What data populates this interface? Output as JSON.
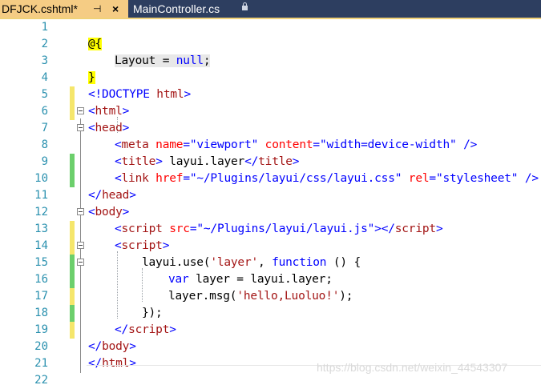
{
  "tabs": [
    {
      "label": "DFJCK.cshtml*",
      "pin": "⊣",
      "close": "×",
      "active": true
    },
    {
      "label": "MainController.cs",
      "locked": true,
      "active": false
    }
  ],
  "editor": {
    "line_numbers": [
      "1",
      "2",
      "3",
      "4",
      "5",
      "6",
      "7",
      "8",
      "9",
      "10",
      "11",
      "12",
      "13",
      "14",
      "15",
      "16",
      "17",
      "18",
      "19",
      "20",
      "21",
      "22"
    ],
    "l2": {
      "razor": "@{"
    },
    "l3": {
      "layout": "Layout",
      "eq": " = ",
      "null": "null",
      "semi": ";"
    },
    "l4": {
      "razor": "}"
    },
    "l5": {
      "open": "<!DOCTYPE",
      "name": " html",
      "close": ">"
    },
    "l6": {
      "open": "<",
      "tag": "html",
      "close": ">"
    },
    "l7": {
      "open": "<",
      "tag": "head",
      "close": ">"
    },
    "l8": {
      "open": "<",
      "tag": "meta",
      "a1": " name",
      "eq1": "=",
      "v1": "\"viewport\"",
      "a2": " content",
      "eq2": "=",
      "v2": "\"width=device-width\"",
      "close": " />"
    },
    "l9": {
      "open": "<",
      "tag": "title",
      "close": ">",
      "text": " layui.layer",
      "open2": "</",
      "tag2": "title",
      "close2": ">"
    },
    "l10": {
      "open": "<",
      "tag": "link",
      "a1": " href",
      "eq1": "=",
      "v1": "\"~/Plugins/layui/css/layui.css\"",
      "a2": " rel",
      "eq2": "=",
      "v2": "\"stylesheet\"",
      "close": " />"
    },
    "l11": {
      "open": "</",
      "tag": "head",
      "close": ">"
    },
    "l12": {
      "open": "<",
      "tag": "body",
      "close": ">"
    },
    "l13": {
      "open": "<",
      "tag": "script",
      "a1": " src",
      "eq1": "=",
      "v1": "\"~/Plugins/layui/layui.js\"",
      "close": ">",
      "open2": "</",
      "tag2": "script",
      "close2": ">"
    },
    "l14": {
      "open": "<",
      "tag": "script",
      "close": ">"
    },
    "l15": {
      "p1": "layui.use(",
      "s1": "'layer'",
      "p2": ", ",
      "kw": "function",
      "p3": " () {"
    },
    "l16": {
      "kw": "var",
      "p1": " layer = layui.layer;"
    },
    "l17": {
      "p1": "layer.msg(",
      "s1": "'hello,Luoluo!'",
      "p2": ");"
    },
    "l18": {
      "p1": "});"
    },
    "l19": {
      "open": "</",
      "tag": "script",
      "close": ">"
    },
    "l20": {
      "open": "</",
      "tag": "body",
      "close": ">"
    },
    "l21": {
      "open": "</",
      "tag": "html",
      "close": ">"
    }
  },
  "colors": {
    "tab_bar": "#2d3e60",
    "active_tab": "#f5cc84",
    "saved_change": "#6ccf6c",
    "unsaved_change": "#f5e66b",
    "line_number": "#2b91af"
  },
  "watermark": "https://blog.csdn.net/weixin_44543307"
}
